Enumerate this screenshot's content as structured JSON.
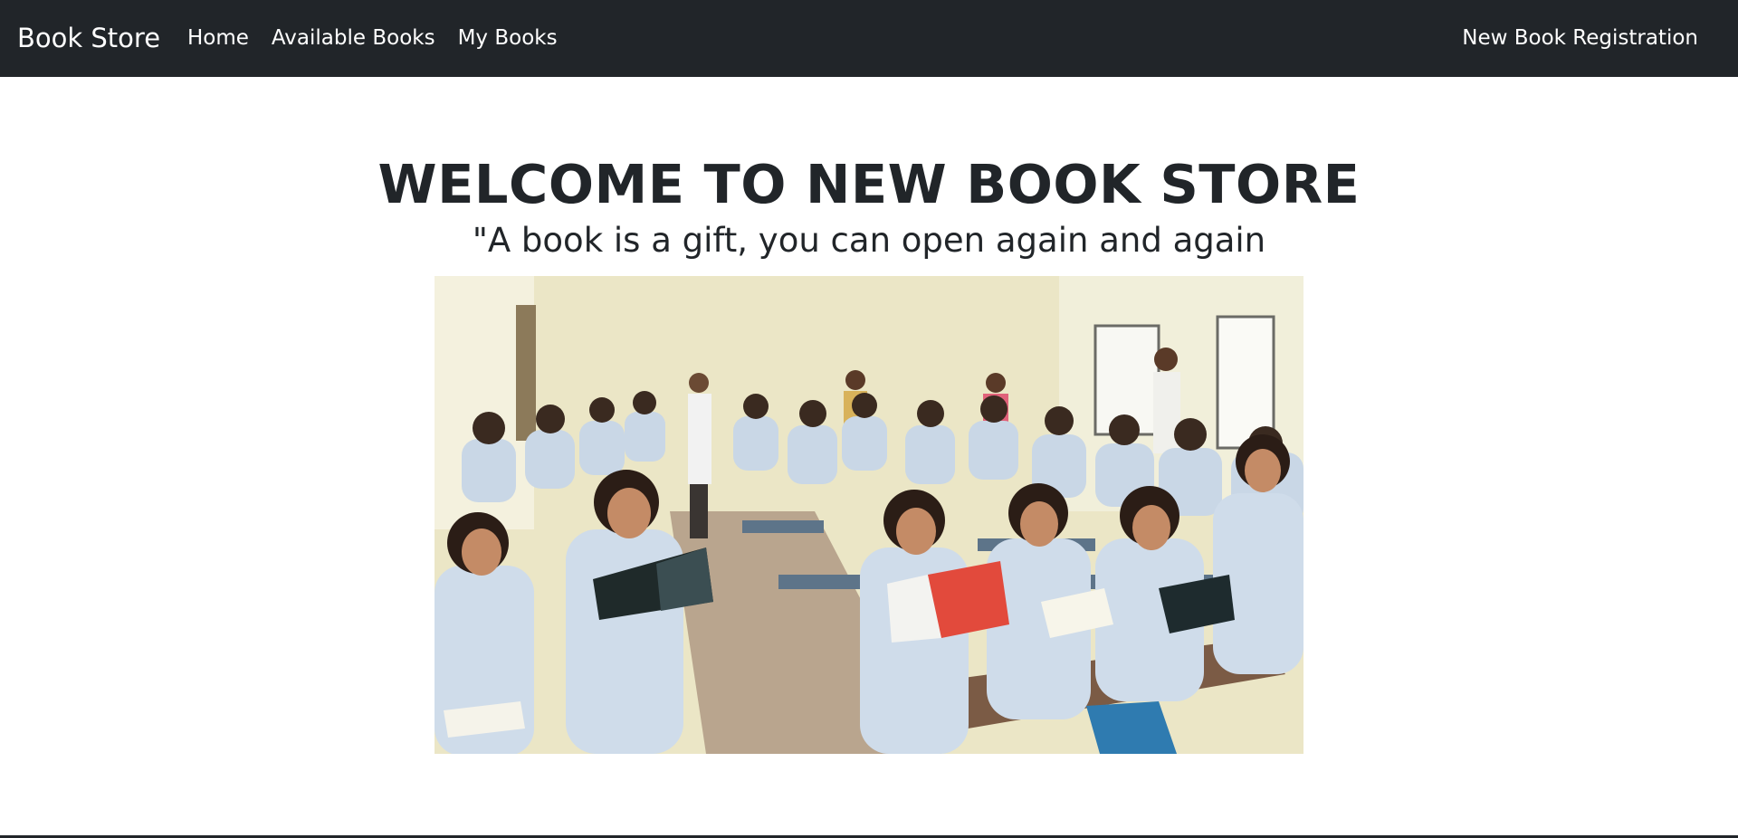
{
  "navbar": {
    "brand": "Book Store",
    "links": [
      {
        "label": "Home"
      },
      {
        "label": "Available Books"
      },
      {
        "label": "My Books"
      }
    ],
    "right_link": "New Book Registration"
  },
  "hero": {
    "title": "WELCOME TO NEW BOOK STORE",
    "subtitle": "\"A book is a gift, you can open again and again",
    "image_alt": "Students reading books in a classroom"
  },
  "colors": {
    "navbar_bg": "#212529",
    "nav_text": "#ffffff",
    "page_bg": "#ffffff",
    "heading_text": "#212529"
  }
}
